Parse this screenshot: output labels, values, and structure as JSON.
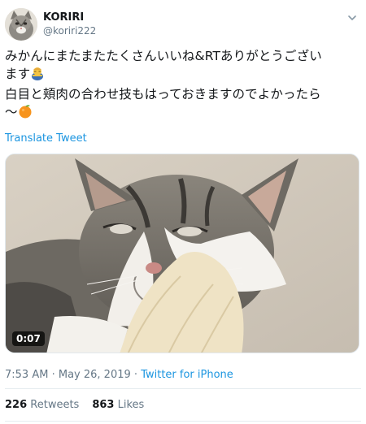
{
  "author": {
    "name": "KORIRI",
    "handle": "@koriri222"
  },
  "tweet": {
    "lines": [
      "みかんにまたまたたくさんいいね&RTありがとうござい",
      "ます",
      "白目と頬肉の合わせ技もはっておきますのでよかったら",
      "〜"
    ],
    "translate_label": "Translate Tweet"
  },
  "media": {
    "duration": "0:07"
  },
  "meta": {
    "time": "7:53 AM",
    "separator": "·",
    "date": "May 26, 2019",
    "source": "Twitter for iPhone"
  },
  "stats": {
    "retweets_count": "226",
    "retweets_label": "Retweets",
    "likes_count": "863",
    "likes_label": "Likes"
  },
  "icons": {
    "caret": "chevron-down-icon",
    "emoji_1": "person-bowing-emoji",
    "emoji_2": "tangerine-emoji"
  },
  "colors": {
    "link": "#1b95e0",
    "secondary_text": "#657786",
    "primary_text": "#14171a"
  }
}
